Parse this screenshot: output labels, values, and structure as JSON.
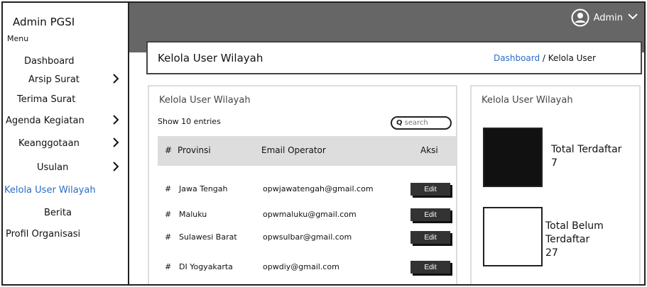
{
  "sidebar": {
    "brand": "Admin PGSI",
    "menu_label": "Menu",
    "items": [
      {
        "label": "Dashboard",
        "chevron": false,
        "active": false
      },
      {
        "label": "Arsip Surat",
        "chevron": true,
        "active": false
      },
      {
        "label": "Terima Surat",
        "chevron": false,
        "active": false
      },
      {
        "label": "Agenda Kegiatan",
        "chevron": true,
        "active": false
      },
      {
        "label": "Keanggotaan",
        "chevron": true,
        "active": false
      },
      {
        "label": "Usulan",
        "chevron": true,
        "active": false
      },
      {
        "label": "Kelola User Wilayah",
        "chevron": false,
        "active": true
      },
      {
        "label": "Berita",
        "chevron": false,
        "active": false
      },
      {
        "label": "Profil Organisasi",
        "chevron": false,
        "active": false
      }
    ]
  },
  "header": {
    "user_name": "Admin",
    "user_icon": "user-circle-icon",
    "dropdown_icon": "chevron-down-icon"
  },
  "title_bar": {
    "title": "Kelola User Wilayah",
    "breadcrumb_link": "Dashboard",
    "breadcrumb_sep": " / ",
    "breadcrumb_current": "Kelola User"
  },
  "main": {
    "title": "Kelola User Wilayah",
    "show_entries": "Show 10 entries",
    "search_placeholder": "search",
    "columns": [
      "#",
      "Provinsi",
      "Email Operator",
      "Aksi"
    ],
    "rows": [
      {
        "num": "#",
        "provinsi": "Jawa Tengah",
        "email": "opwjawatengah@gmail.com",
        "action": "Edit"
      },
      {
        "num": "#",
        "provinsi": "Maluku",
        "email": "opwmaluku@gmail.com",
        "action": "Edit"
      },
      {
        "num": "#",
        "provinsi": "Sulawesi Barat",
        "email": "opwsulbar@gmail.com",
        "action": "Edit"
      },
      {
        "num": "#",
        "provinsi": "DI Yogyakarta",
        "email": "opwdiy@gmail.com",
        "action": "Edit"
      }
    ]
  },
  "side_panel": {
    "title": "Kelola User Wilayah",
    "registered_label": "Total Terdaftar",
    "registered_value": "7",
    "unregistered_label_1": "Total Belum",
    "unregistered_label_2": "Terdaftar",
    "unregistered_value": "27"
  },
  "colors": {
    "topbar": "#666666",
    "active_link": "#2b6cc4",
    "table_header": "#dddddd",
    "edit_button": "#333333"
  }
}
